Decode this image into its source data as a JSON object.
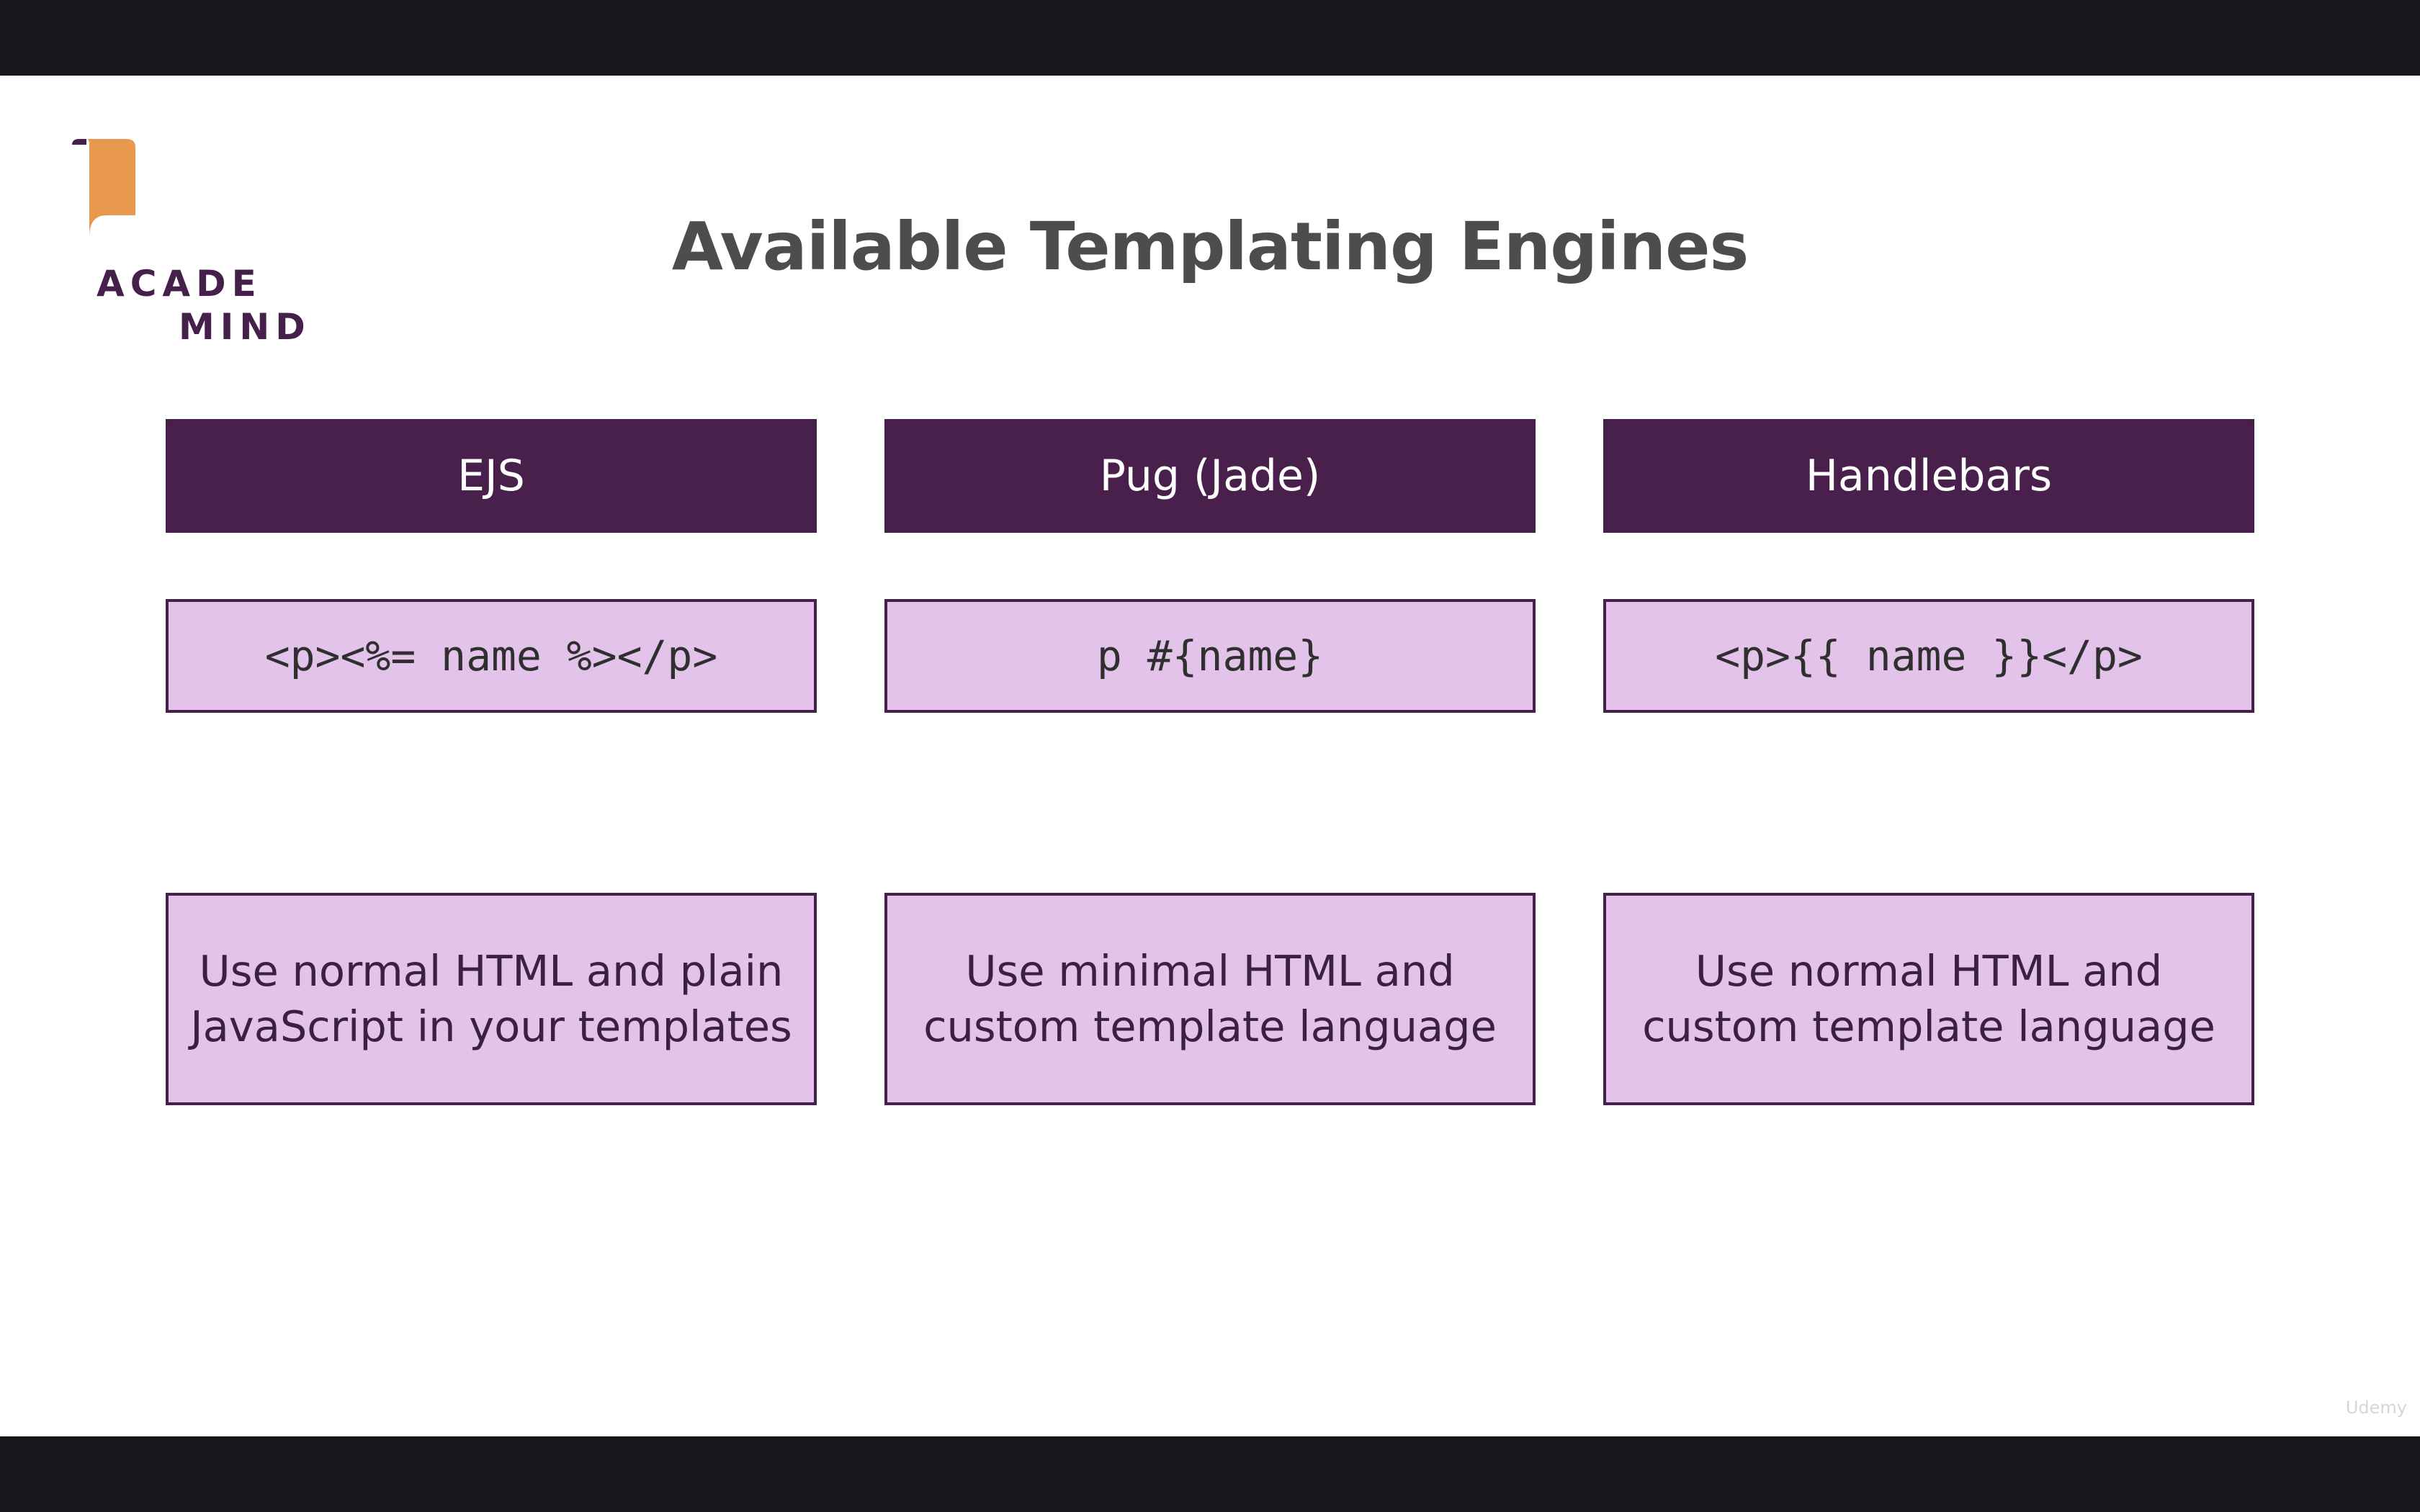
{
  "slide": {
    "title": "Available Templating Engines",
    "logo": {
      "line1": "ACADE",
      "line2": "MIND",
      "colors": {
        "scroll": "#e8994e",
        "text": "#44204a"
      }
    },
    "engines": [
      {
        "name": "EJS",
        "syntax": "<p><%= name %></p>",
        "description": "Use normal HTML and plain\nJavaScript in your templates"
      },
      {
        "name": "Pug (Jade)",
        "syntax": "p #{name}",
        "description": "Use minimal HTML and\ncustom template language"
      },
      {
        "name": "Handlebars",
        "syntax": "<p>{{ name }}</p>",
        "description": "Use normal  HTML and\ncustom template language"
      }
    ],
    "watermark": "Udemy"
  },
  "colors": {
    "header_bg": "#48204b",
    "box_bg": "#e4c3ea",
    "border": "#44204a",
    "letterbox": "#16171c"
  }
}
